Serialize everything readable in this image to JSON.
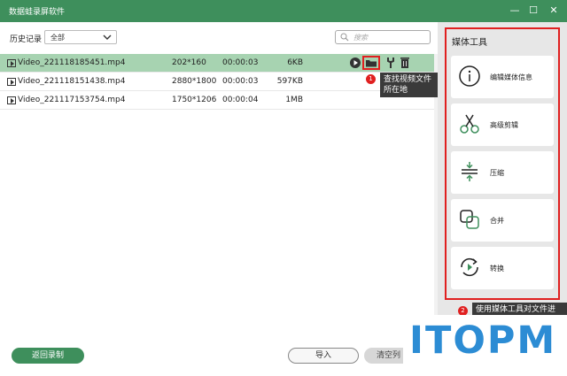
{
  "window": {
    "title": "数据蛙录屏软件",
    "min_glyph": "—",
    "max_glyph": "☐",
    "close_glyph": "✕"
  },
  "toolbar": {
    "history_label": "历史记录",
    "filter_value": "全部",
    "search_placeholder": "搜索"
  },
  "files": [
    {
      "name": "Video_221118185451.mp4",
      "resolution": "202*160",
      "duration": "00:00:03",
      "size": "6KB",
      "selected": true
    },
    {
      "name": "Video_221118151438.mp4",
      "resolution": "2880*1800",
      "duration": "00:00:03",
      "size": "597KB",
      "selected": false
    },
    {
      "name": "Video_221117153754.mp4",
      "resolution": "1750*1206",
      "duration": "00:00:04",
      "size": "1MB",
      "selected": false
    }
  ],
  "annotations": {
    "badge1": "1",
    "tooltip1_line1": "查找视频文件",
    "tooltip1_line2": "所在地",
    "badge2": "2",
    "tooltip2": "使用媒体工具对文件进"
  },
  "bottom": {
    "back_label": "返回录制",
    "import_label": "导入",
    "clear_label": "清空列"
  },
  "media_tools": {
    "title": "媒体工具",
    "items": [
      {
        "label": "编辑媒体信息",
        "icon": "info-icon"
      },
      {
        "label": "高级剪辑",
        "icon": "scissors-icon"
      },
      {
        "label": "压缩",
        "icon": "compress-icon"
      },
      {
        "label": "合并",
        "icon": "merge-icon"
      },
      {
        "label": "转换",
        "icon": "convert-icon"
      }
    ]
  },
  "watermark": "ITOPM",
  "colors": {
    "accent": "#3e8f5c",
    "selected_row": "#a7d3b1",
    "highlight": "#e02020",
    "watermark": "#2c8cd4"
  }
}
